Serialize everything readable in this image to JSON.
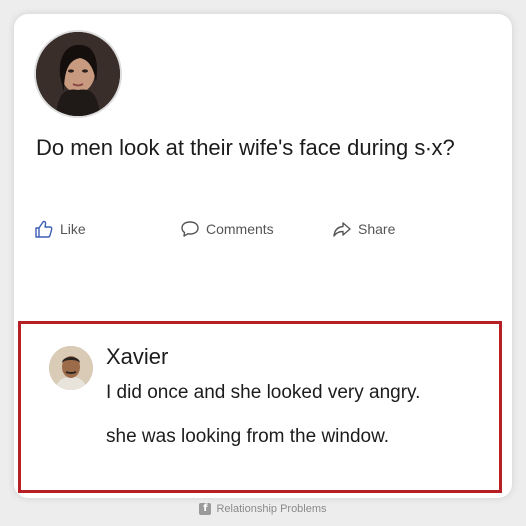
{
  "post": {
    "text": "Do men look at their wife's face during s∙x?",
    "avatar_icon": "user-avatar-woman"
  },
  "actions": {
    "like_label": "Like",
    "comments_label": "Comments",
    "share_label": "Share"
  },
  "comment": {
    "author": "Xavier",
    "line1": "I did once and she looked very angry.",
    "line2": "she was looking from the window.",
    "avatar_icon": "user-avatar-man",
    "highlight_color": "#b62024"
  },
  "footer": {
    "icon": "facebook-icon",
    "label": "Relationship Problems"
  }
}
